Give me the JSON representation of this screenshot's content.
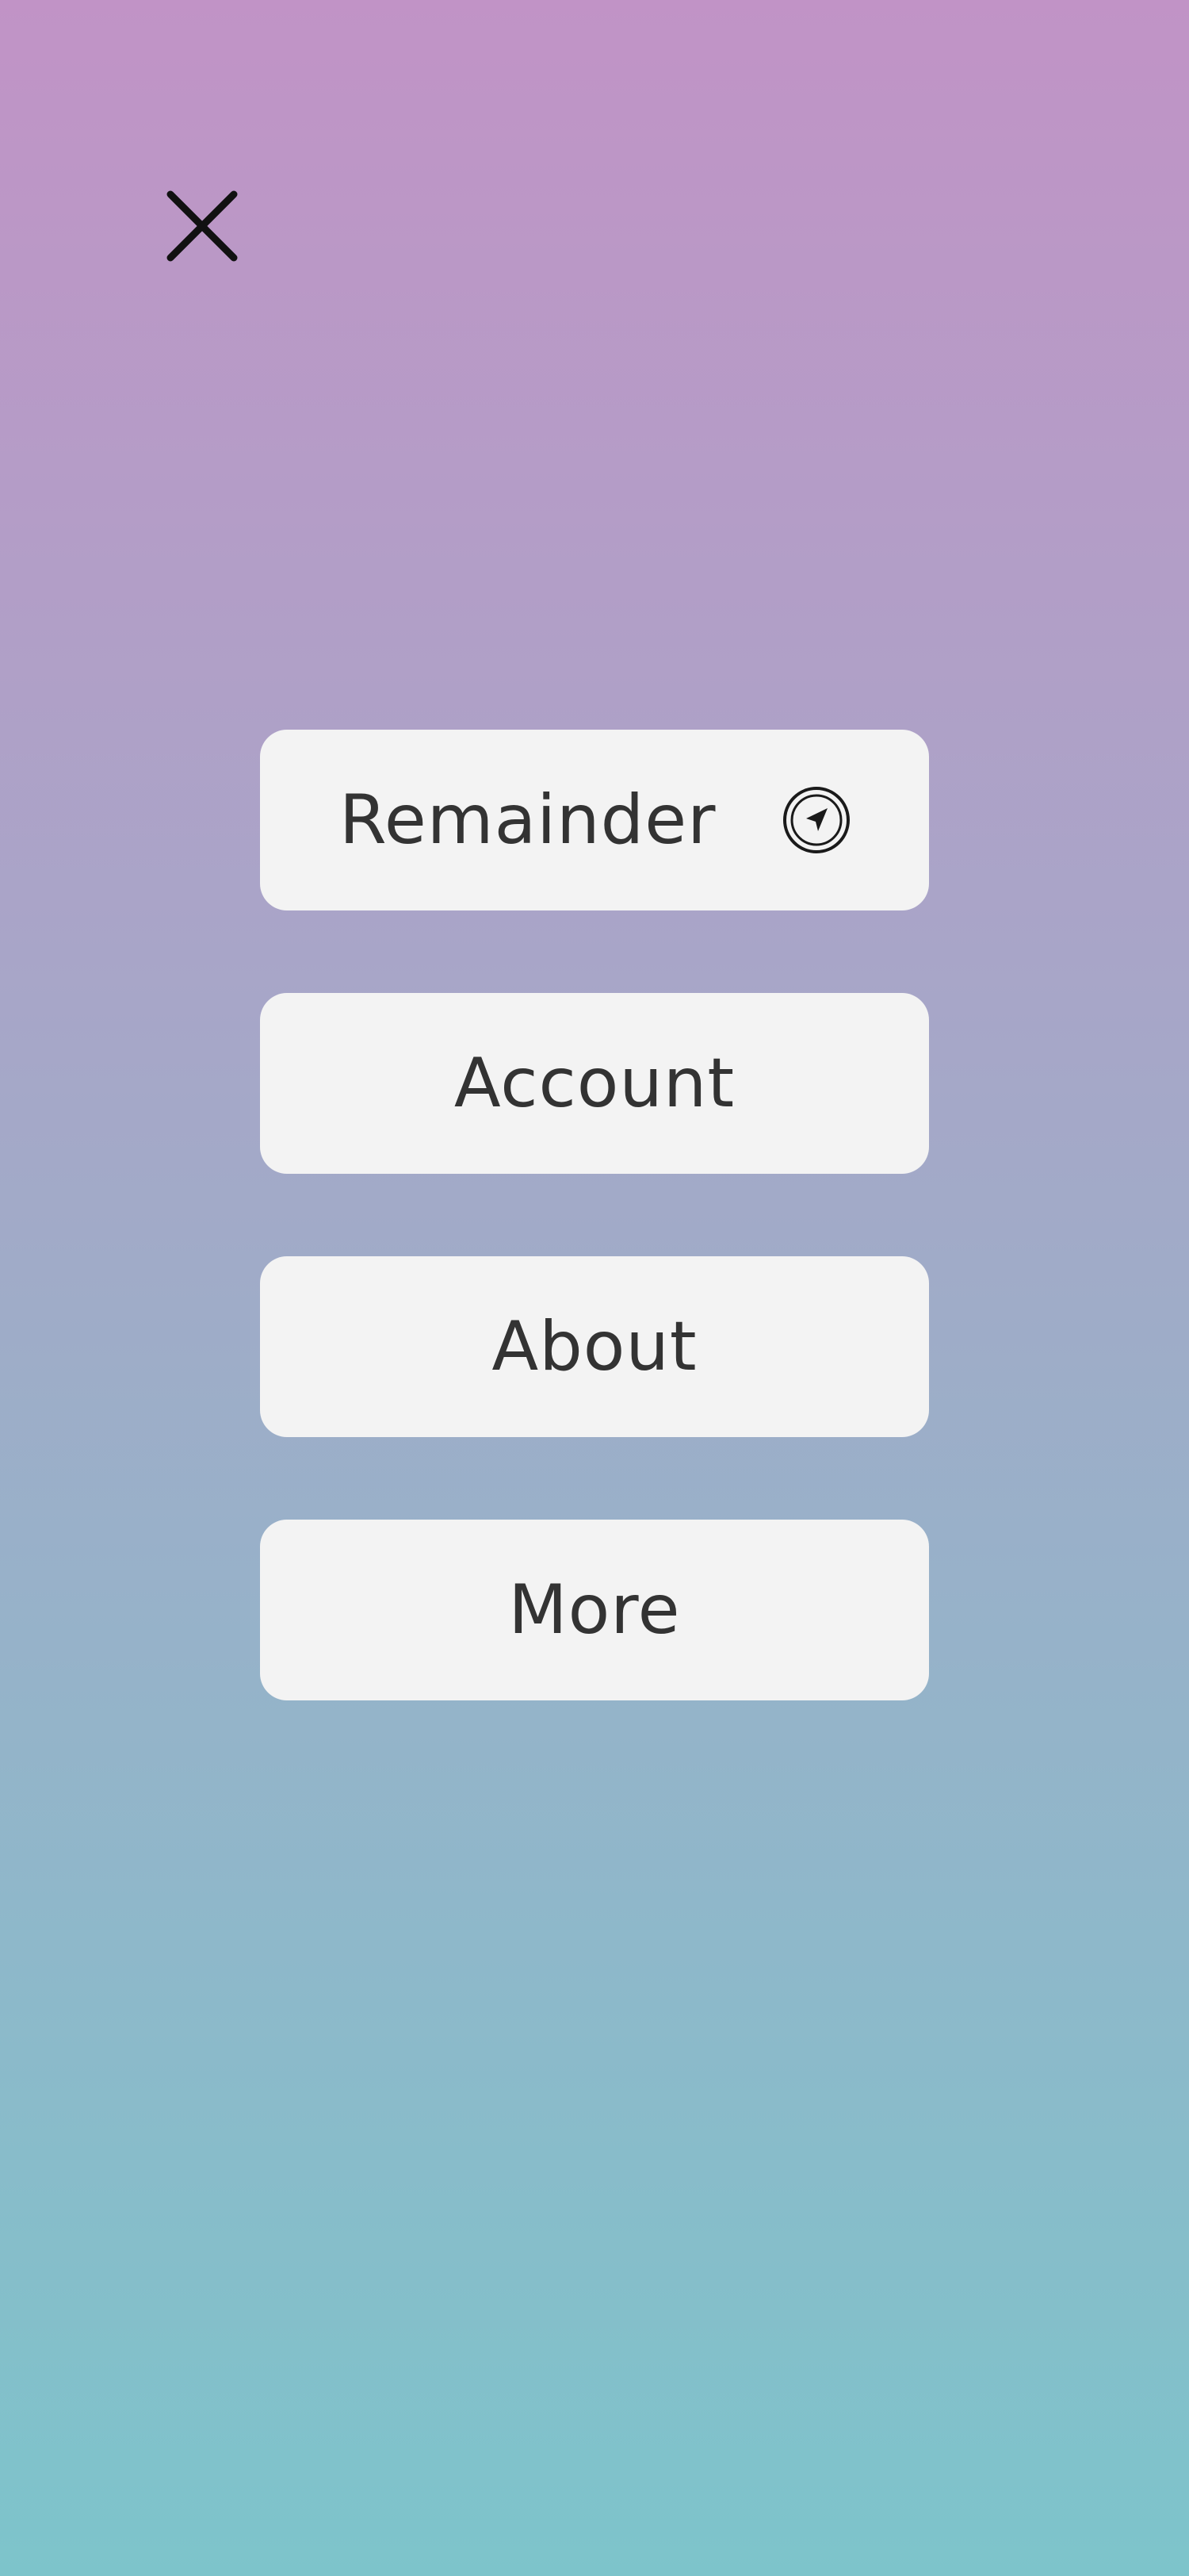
{
  "header": {
    "close_icon": "close-icon"
  },
  "menu": {
    "items": [
      {
        "label": "Remainder",
        "icon": "navigation-arrow-icon"
      },
      {
        "label": "Account"
      },
      {
        "label": "About"
      },
      {
        "label": "More"
      }
    ]
  },
  "colors": {
    "gradient_top": "#c193c6",
    "gradient_bottom": "#7dc4cb",
    "button_bg": "#f3f3f3",
    "text": "#333333"
  }
}
